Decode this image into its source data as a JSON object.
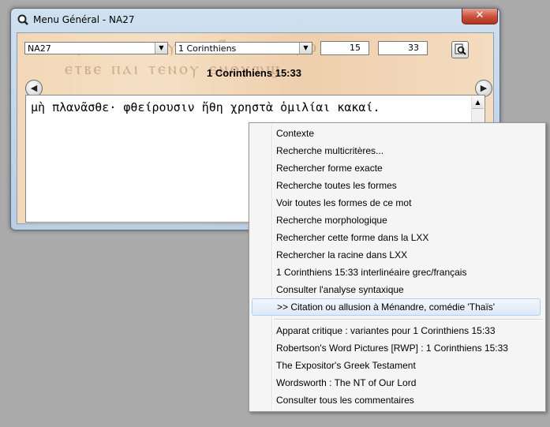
{
  "window": {
    "title": "Menu Général - NA27",
    "close_label": "✕"
  },
  "toolbar": {
    "version_select": "NA27",
    "book_select": "1 Corinthiens",
    "chapter_value": "15",
    "verse_value": "33"
  },
  "reference_title": "1 Corinthiens 15:33",
  "greek_text": "μὴ πλανᾶσθε· φθείρουσιν ἤθη χρηστὰ ὁμιλίαι κακαί.",
  "manuscript_lines": [
    "ⲁⲩⲱ ⲡⲉⲓ ⲙⲟⲩⲧⲉ ⲁϥⲥⲱⲧⲙ ⲁⲩⲱ",
    "ⲉⲧⲃⲉ ⲡⲁⲓ ⲧⲉⲛⲟⲩ ⲉⲛⲟⲩⲱϣ"
  ],
  "context_menu": {
    "items": [
      "Contexte",
      "Recherche multicritères...",
      "Rechercher forme exacte",
      "Recherche toutes les formes",
      "Voir toutes les formes de ce mot",
      "Recherche morphologique",
      "Rechercher cette forme dans la LXX",
      "Rechercher la racine dans LXX",
      "1 Corinthiens 15:33 interlinéaire grec/français",
      "Consulter l'analyse syntaxique",
      ">> Citation ou allusion à Ménandre, comédie 'Thaïs'",
      "Apparat critique : variantes pour 1 Corinthiens 15:33",
      "Robertson's Word Pictures [RWP] : 1 Corinthiens 15:33",
      "The Expositor's Greek Testament",
      "Wordsworth : The NT of Our Lord",
      "Consulter tous les commentaires"
    ],
    "highlighted_index": 10
  }
}
